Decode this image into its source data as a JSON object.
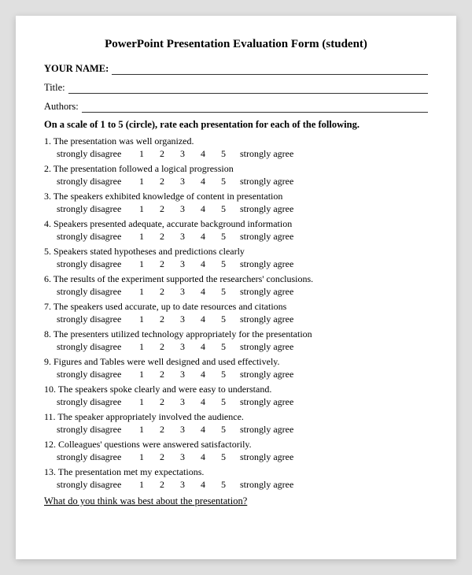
{
  "title": "PowerPoint Presentation Evaluation Form (student)",
  "fields": {
    "your_name_label": "YOUR NAME:",
    "title_label": "Title:",
    "authors_label": "Authors:"
  },
  "instructions": "On a scale of 1 to 5 (circle), rate each presentation for each of the following.",
  "scale": {
    "disagree": "strongly disagree",
    "numbers": [
      "1",
      "2",
      "3",
      "4",
      "5"
    ],
    "agree": "strongly agree"
  },
  "questions": [
    {
      "num": "1.",
      "text": "The presentation was well organized."
    },
    {
      "num": "2.",
      "text": "The presentation followed a logical progression"
    },
    {
      "num": "3.",
      "text": "The speakers exhibited knowledge of content in presentation"
    },
    {
      "num": "4.",
      "text": "Speakers presented adequate, accurate background information"
    },
    {
      "num": "5.",
      "text": "Speakers stated hypotheses and predictions clearly"
    },
    {
      "num": "6.",
      "text": "The results of the experiment supported the researchers' conclusions."
    },
    {
      "num": "7.",
      "text": "The speakers used accurate, up to date resources and citations"
    },
    {
      "num": "8.",
      "text": "The presenters utilized technology appropriately for the presentation"
    },
    {
      "num": "9.",
      "text": "Figures and Tables were well designed and used effectively."
    },
    {
      "num": "10.",
      "text": "The speakers spoke clearly and were easy to understand."
    },
    {
      "num": "11.",
      "text": "The speaker appropriately involved the audience."
    },
    {
      "num": "12.",
      "text": "Colleagues' questions were answered satisfactorily."
    },
    {
      "num": "13.",
      "text": "The presentation met my expectations."
    }
  ],
  "footer": "What do you think was best about the presentation?"
}
